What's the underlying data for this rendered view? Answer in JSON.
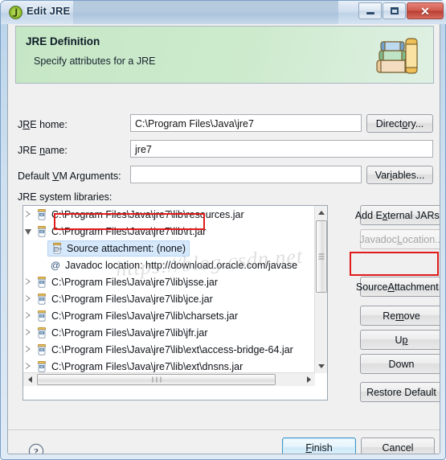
{
  "window": {
    "title": "Edit JRE",
    "title_icon": "jre-green-circle-icon",
    "controls": {
      "minimize": "minimize-icon",
      "maximize": "maximize-icon",
      "close": "close-icon"
    }
  },
  "banner": {
    "title": "JRE Definition",
    "subtitle": "Specify attributes for a JRE",
    "icon": "books-stack-icon",
    "bg_color": "#c8e8c8"
  },
  "form": {
    "jre_home": {
      "label_pre": "J",
      "label_accel": "R",
      "label_post": "E home:",
      "label": "JRE home:",
      "value": "C:\\Program Files\\Java\\jre7",
      "placeholder": ""
    },
    "jre_name": {
      "label": "JRE name:",
      "label_pre": "JRE ",
      "label_accel": "n",
      "label_post": "ame:",
      "value": "jre7",
      "placeholder": ""
    },
    "vm_args": {
      "label": "Default VM Arguments:",
      "label_pre": "Default ",
      "label_accel": "V",
      "label_post": "M Arguments:",
      "value": "",
      "placeholder": ""
    },
    "libraries_label": "JRE system libraries:",
    "directory_button": {
      "label": "Directory...",
      "pre": "Direct",
      "accel": "o",
      "post": "ry..."
    },
    "variables_button": {
      "label": "Variables...",
      "pre": "Var",
      "accel": "i",
      "post": "ables..."
    }
  },
  "tree": {
    "rows": [
      {
        "text": "C:\\Program Files\\Java\\jre7\\lib\\resources.jar",
        "icon": "jar-icon",
        "state": "collapsed",
        "indent": 0,
        "selected": false
      },
      {
        "text": "C:\\Program Files\\Java\\jre7\\lib\\rt.jar",
        "icon": "jar-icon",
        "state": "expanded",
        "indent": 0,
        "selected": false
      },
      {
        "text": "Source attachment: (none)",
        "icon": "source-attachment-icon",
        "state": "leaf",
        "indent": 1,
        "selected": true
      },
      {
        "text": "Javadoc location: http://download.oracle.com/javase",
        "icon": "at-icon",
        "state": "leaf",
        "indent": 1,
        "selected": false
      },
      {
        "text": "C:\\Program Files\\Java\\jre7\\lib\\jsse.jar",
        "icon": "jar-icon",
        "state": "collapsed",
        "indent": 0,
        "selected": false
      },
      {
        "text": "C:\\Program Files\\Java\\jre7\\lib\\jce.jar",
        "icon": "jar-icon",
        "state": "collapsed",
        "indent": 0,
        "selected": false
      },
      {
        "text": "C:\\Program Files\\Java\\jre7\\lib\\charsets.jar",
        "icon": "jar-icon",
        "state": "collapsed",
        "indent": 0,
        "selected": false
      },
      {
        "text": "C:\\Program Files\\Java\\jre7\\lib\\jfr.jar",
        "icon": "jar-icon",
        "state": "collapsed",
        "indent": 0,
        "selected": false
      },
      {
        "text": "C:\\Program Files\\Java\\jre7\\lib\\ext\\access-bridge-64.jar",
        "icon": "jar-icon",
        "state": "collapsed",
        "indent": 0,
        "selected": false
      },
      {
        "text": "C:\\Program Files\\Java\\jre7\\lib\\ext\\dnsns.jar",
        "icon": "jar-icon",
        "state": "collapsed",
        "indent": 0,
        "selected": false
      }
    ],
    "watermark": "https://blog.csdn.net"
  },
  "side_buttons": [
    {
      "label": "Add External JARs...",
      "pre": "Add E",
      "accel": "x",
      "post": "ternal JARs...",
      "disabled": false,
      "highlighted": false,
      "name": "add-external-jars-button"
    },
    {
      "label": "Javadoc Location...",
      "pre": "Javadoc ",
      "accel": "L",
      "post": "ocation...",
      "disabled": true,
      "highlighted": false,
      "name": "javadoc-location-button"
    },
    {
      "label": "Source Attachment...",
      "pre": "Source ",
      "accel": "A",
      "post": "ttachment...",
      "disabled": false,
      "highlighted": true,
      "name": "source-attachment-button"
    },
    {
      "label": "Remove",
      "pre": "Re",
      "accel": "m",
      "post": "ove",
      "disabled": false,
      "highlighted": false,
      "name": "remove-button"
    },
    {
      "label": "Up",
      "pre": "U",
      "accel": "p",
      "post": "",
      "disabled": false,
      "highlighted": false,
      "name": "up-button"
    },
    {
      "label": "Down",
      "pre": "Down",
      "accel": "",
      "post": "",
      "disabled": false,
      "highlighted": false,
      "name": "down-button"
    },
    {
      "label": "Restore Default",
      "pre": "Restore Default",
      "accel": "",
      "post": "",
      "disabled": false,
      "highlighted": false,
      "name": "restore-default-button"
    }
  ],
  "footer": {
    "help_icon": "help-question-icon",
    "finish_button": {
      "label": "Finish",
      "pre": "",
      "accel": "F",
      "post": "inish",
      "default": true
    },
    "cancel_button": {
      "label": "Cancel",
      "pre": "Cancel",
      "accel": "",
      "post": ""
    }
  },
  "colors": {
    "banner_green": "#c8e8c8",
    "annotation_red": "#e01b1b",
    "selection_blue": "#d6e8fb",
    "default_button_blue": "#3d95c9"
  }
}
